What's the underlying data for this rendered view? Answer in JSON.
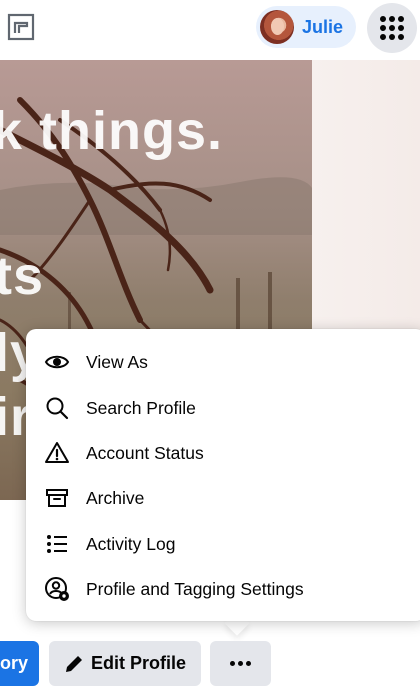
{
  "header": {
    "user_name": "Julie"
  },
  "cover": {
    "words": [
      "k things.",
      "ts",
      "ly",
      "ir"
    ]
  },
  "dropdown": {
    "items": [
      {
        "label": "View As",
        "icon": "eye-icon"
      },
      {
        "label": "Search Profile",
        "icon": "search-icon"
      },
      {
        "label": "Account Status",
        "icon": "warning-triangle-icon"
      },
      {
        "label": "Archive",
        "icon": "archive-box-icon"
      },
      {
        "label": "Activity Log",
        "icon": "list-icon"
      },
      {
        "label": "Profile and Tagging Settings",
        "icon": "profile-settings-gear-icon"
      }
    ]
  },
  "actions": {
    "story_label": "ory",
    "edit_profile_label": "Edit Profile"
  },
  "colors": {
    "accent": "#1b74e4",
    "button_gray": "#e4e6eb",
    "chip_bg": "#e7f0fd"
  }
}
